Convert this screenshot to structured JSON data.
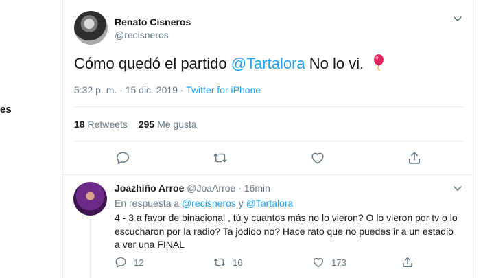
{
  "left_nav": {
    "fragment_label": "es"
  },
  "tweet": {
    "author_name": "Renato Cisneros",
    "author_handle": "@recisneros",
    "text_before": "Cómo quedó el partido ",
    "mention": "@Tartalora",
    "text_after": " No lo vi. ",
    "emoji": "balloon",
    "time_date": "5:32 p. m. · 15 dic. 2019 · ",
    "source": "Twitter for iPhone",
    "retweets_count": "18",
    "retweets_label": "Retweets",
    "likes_count": "295",
    "likes_label": "Me gusta"
  },
  "actions": [
    "reply-icon",
    "retweet-icon",
    "like-icon",
    "share-icon"
  ],
  "reply": {
    "author_name": "Joazhiño Arroe",
    "author_handle": "@JoaArroe",
    "separator": " · ",
    "time": "16min",
    "context_prefix": "En respuesta a ",
    "context_mention_1": "@recisneros",
    "context_and": " y ",
    "context_mention_2": "@Tartalora",
    "body": "4 - 3 a favor de binacional , tú y cuantos más no lo vieron? O lo vieron por tv o lo escucharon por la radio? Ta jodido no? Hace rato que no puedes ir a un estadio a ver una FINAL",
    "reply_count": "12",
    "retweet_count": "16",
    "like_count": "173"
  },
  "colors": {
    "accent": "#1da1f2",
    "muted": "#657786",
    "text": "#14171a",
    "border": "#e6ecf0"
  }
}
